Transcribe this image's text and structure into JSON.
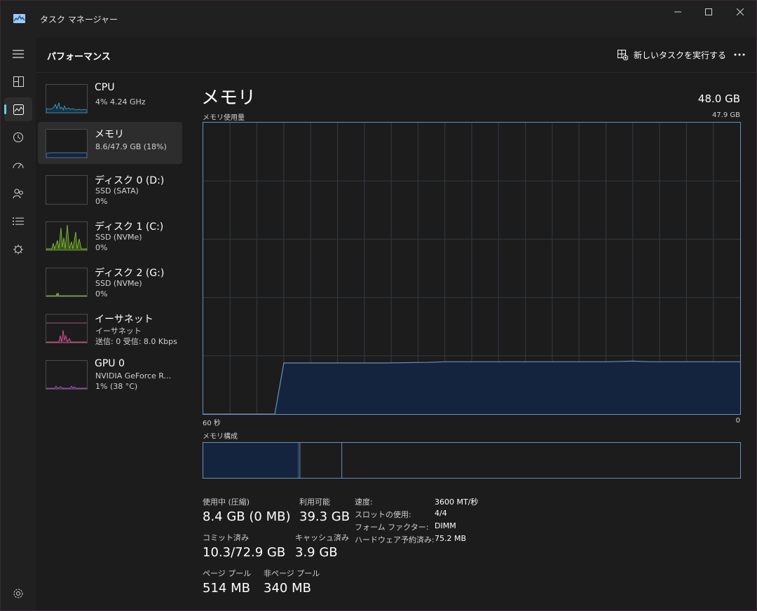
{
  "window": {
    "title": "タスク マネージャー",
    "accent_color": "#60cdff",
    "chart_line_color": "#6c8fb8",
    "chart_fill_color": "#15243e"
  },
  "nav": {
    "icons": [
      "hamburger-icon",
      "processes-icon",
      "performance-icon",
      "app-history-icon",
      "startup-icon",
      "users-icon",
      "details-icon",
      "services-icon",
      "settings-icon"
    ]
  },
  "header": {
    "title": "パフォーマンス",
    "run_task_label": "新しいタスクを実行する"
  },
  "perf_items": [
    {
      "name": "CPU",
      "line1": "4%  4.24 GHz",
      "line2": "",
      "color": "#4aa3d6"
    },
    {
      "name": "メモリ",
      "line1": "8.6/47.9 GB (18%)",
      "line2": "",
      "color": "#6c8fb8"
    },
    {
      "name": "ディスク 0 (D:)",
      "line1": "SSD (SATA)",
      "line2": "0%",
      "color": "#7cb342"
    },
    {
      "name": "ディスク 1 (C:)",
      "line1": "SSD (NVMe)",
      "line2": "0%",
      "color": "#8bc34a"
    },
    {
      "name": "ディスク 2 (G:)",
      "line1": "SSD (NVMe)",
      "line2": "0%",
      "color": "#8bc34a"
    },
    {
      "name": "イーサネット",
      "line1": "イーサネット",
      "line2": "送信: 0 受信: 8.0 Kbps",
      "color": "#d9609b"
    },
    {
      "name": "GPU 0",
      "line1": "NVIDIA GeForce R...",
      "line2": "1%  (38 °C)",
      "color": "#b05cc8"
    }
  ],
  "detail": {
    "title": "メモリ",
    "total": "48.0 GB",
    "usage_label": "メモリ使用量",
    "usage_max": "47.9 GB",
    "time_left": "60 秒",
    "time_right": "0",
    "composition_label": "メモリ構成"
  },
  "stats": {
    "in_use_label": "使用中 (圧縮)",
    "in_use_value": "8.4 GB (0 MB)",
    "available_label": "利用可能",
    "available_value": "39.3 GB",
    "committed_label": "コミット済み",
    "committed_value": "10.3/72.9 GB",
    "cached_label": "キャッシュ済み",
    "cached_value": "3.9 GB",
    "paged_label": "ページ プール",
    "paged_value": "514 MB",
    "nonpaged_label": "非ページ プール",
    "nonpaged_value": "340 MB"
  },
  "specs": [
    {
      "label": "速度:",
      "value": "3600 MT/秒"
    },
    {
      "label": "スロットの使用:",
      "value": "4/4"
    },
    {
      "label": "フォーム ファクター:",
      "value": "DIMM"
    },
    {
      "label": "ハードウェア予約済み:",
      "value": "75.2 MB"
    }
  ],
  "chart_data": {
    "type": "area",
    "title": "メモリ使用量",
    "xlabel": "",
    "ylabel": "",
    "x_range": [
      60,
      0
    ],
    "ylim": [
      0,
      47.9
    ],
    "grid": true,
    "series": [
      {
        "values": [
          [
            60,
            0
          ],
          [
            52,
            0
          ],
          [
            51,
            8.4
          ],
          [
            45,
            8.4
          ],
          [
            40,
            8.4
          ],
          [
            35,
            8.5
          ],
          [
            33,
            8.6
          ],
          [
            30,
            8.6
          ],
          [
            27,
            8.6
          ],
          [
            25,
            8.6
          ],
          [
            20,
            8.6
          ],
          [
            15,
            8.6
          ],
          [
            12,
            8.7
          ],
          [
            10,
            8.6
          ],
          [
            5,
            8.6
          ],
          [
            0,
            8.6
          ]
        ]
      }
    ],
    "composition": {
      "segments": [
        {
          "name": "in_use",
          "fraction": 0.177
        },
        {
          "name": "modified",
          "fraction": 0.003
        },
        {
          "name": "standby",
          "fraction": 0.078
        },
        {
          "name": "free",
          "fraction": 0.742
        }
      ]
    }
  }
}
